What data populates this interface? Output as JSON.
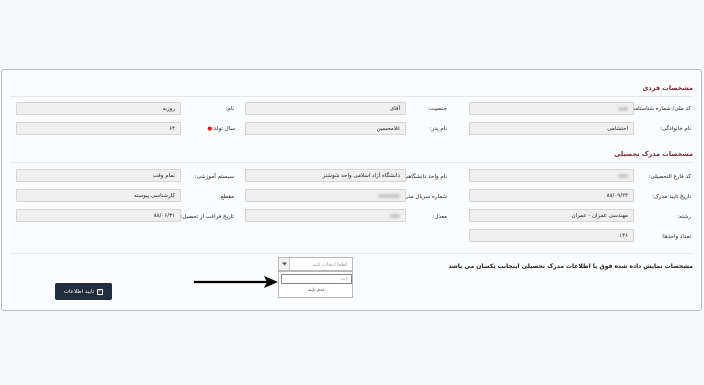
{
  "personal": {
    "title": "مشخصات فردی",
    "national_id_label": "کد ملی/ شماره شناسنامه:",
    "gender_label": "جنسیت:",
    "gender_value": "آقای",
    "name_label": "نام:",
    "name_value": "روزبه",
    "family_label": "نام خانوادگی:",
    "family_value": "احتشامی",
    "father_label": "نام پدر:",
    "father_value": "غلامحسین",
    "birth_year_label": "سال تولد:",
    "birth_year_value": "۶۴"
  },
  "education": {
    "title": "مشخصات مدرک تحصیلی",
    "grad_code_label": "کد فارغ التحصیلی:",
    "university_label": "نام واحد دانشگاهی:",
    "university_value": "دانشگاه آزاد اسلامی واحد شوشتر",
    "system_label": "سیستم آموزشی:",
    "system_value": "تمام وقت",
    "approval_date_label": "تاریخ تایید مدرک:",
    "approval_date_value": "۸۸/۰۹/۲۴",
    "serial_label": "شماره سریال مدرک:",
    "degree_label": "مقطع:",
    "degree_value": "کارشناسی پیوسته",
    "major_label": "رشته:",
    "major_value": "مهندسی عمران - عمران",
    "average_label": "معدل:",
    "grad_date_label": "تاریخ فراغت از تحصیل:",
    "grad_date_value": "۸۸/۰۶/۳۱",
    "units_label": "تعداد واحدها:",
    "units_value": "۱۴۶"
  },
  "confirm": {
    "question": "مشخصات نمایش داده شده فوق با اطلاعات مدرک تحصیلی اینجانب یکسان می باشد",
    "select_placeholder": "لطفا انتخاب کنید",
    "options": [
      "تایید",
      "عدم تایید"
    ],
    "button_label": "تایید اطلاعات"
  },
  "colors": {
    "section_title": "#7a2430",
    "button_bg": "#1f2d3d",
    "required": "#e02020"
  }
}
